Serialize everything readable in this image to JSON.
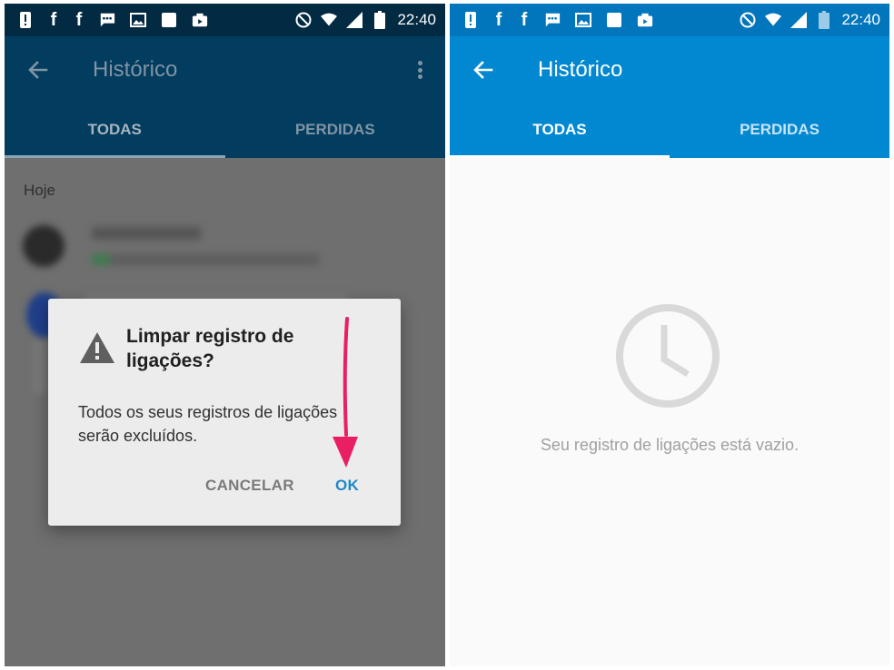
{
  "colors": {
    "accent": "#0288d1",
    "dialog_ok": "#1e88c9",
    "arrow": "#e91e63"
  },
  "status_bar": {
    "time_left": "22:40",
    "time_right": "22:40",
    "notification_icons": [
      "alert-icon",
      "facebook-icon",
      "facebook-icon",
      "message-icon",
      "image-icon",
      "square-icon",
      "media-icon"
    ],
    "system_icons": [
      "do-not-disturb-icon",
      "wifi-icon",
      "signal-icon",
      "battery-icon"
    ]
  },
  "left_screen": {
    "app_title": "Histórico",
    "tabs": [
      {
        "label": "TODAS",
        "active": true
      },
      {
        "label": "PERDIDAS",
        "active": false
      }
    ],
    "section_header": "Hoje",
    "dialog": {
      "title": "Limpar registro de ligações?",
      "message": "Todos os seus registros de ligações serão excluídos.",
      "cancel_label": "CANCELAR",
      "ok_label": "OK"
    }
  },
  "right_screen": {
    "app_title": "Histórico",
    "tabs": [
      {
        "label": "TODAS",
        "active": true
      },
      {
        "label": "PERDIDAS",
        "active": false
      }
    ],
    "empty_message": "Seu registro de ligações está vazio."
  }
}
